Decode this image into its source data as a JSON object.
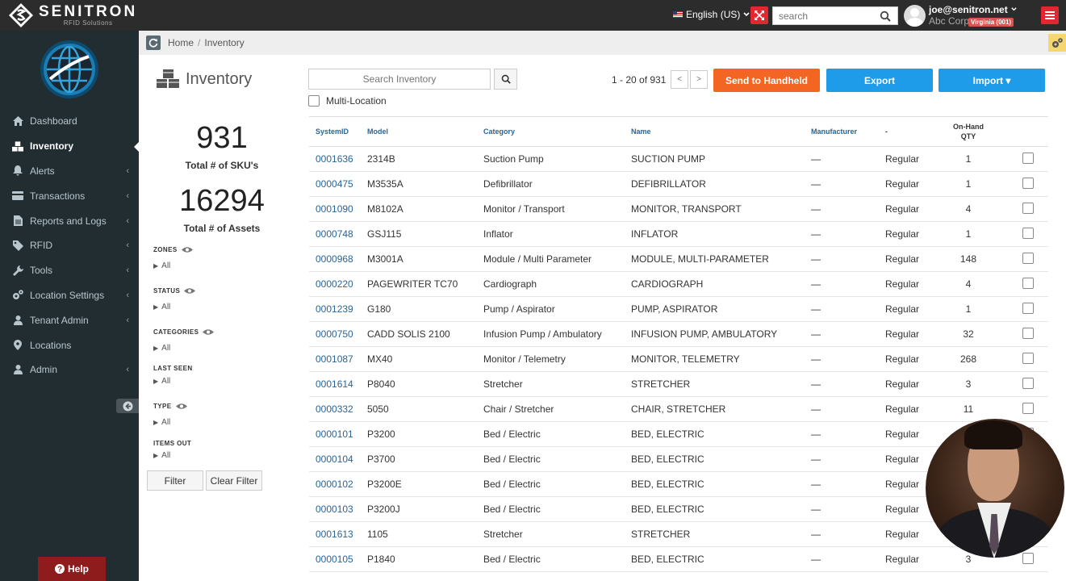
{
  "brand": {
    "name": "SENITRON",
    "sub": "RFID Solutions"
  },
  "topbar": {
    "language": "English (US)",
    "search_placeholder": "search",
    "user_email": "joe@senitron.net",
    "user_company": "Abc Corp",
    "user_location_badge": "Virginia (001)"
  },
  "sidebar": {
    "items": [
      {
        "label": "Dashboard",
        "icon": "home-icon",
        "active": false,
        "has_children": false
      },
      {
        "label": "Inventory",
        "icon": "cubes-icon",
        "active": true,
        "has_children": false
      },
      {
        "label": "Alerts",
        "icon": "bell-icon",
        "active": false,
        "has_children": true
      },
      {
        "label": "Transactions",
        "icon": "card-icon",
        "active": false,
        "has_children": true
      },
      {
        "label": "Reports and Logs",
        "icon": "file-icon",
        "active": false,
        "has_children": true
      },
      {
        "label": "RFID",
        "icon": "tag-icon",
        "active": false,
        "has_children": true
      },
      {
        "label": "Tools",
        "icon": "wrench-icon",
        "active": false,
        "has_children": true
      },
      {
        "label": "Location Settings",
        "icon": "cogs-icon",
        "active": false,
        "has_children": true
      },
      {
        "label": "Tenant Admin",
        "icon": "user-icon",
        "active": false,
        "has_children": true
      },
      {
        "label": "Locations",
        "icon": "map-marker-icon",
        "active": false,
        "has_children": false
      },
      {
        "label": "Admin",
        "icon": "user-icon",
        "active": false,
        "has_children": true
      }
    ],
    "help_label": "Help"
  },
  "breadcrumb": {
    "home": "Home",
    "current": "Inventory"
  },
  "summary": {
    "title": "Inventory",
    "sku_count": "931",
    "sku_label": "Total # of SKU's",
    "asset_count": "16294",
    "asset_label": "Total # of Assets"
  },
  "filters": {
    "groups": [
      {
        "label": "ZONES",
        "value": "All",
        "has_eye": true
      },
      {
        "label": "STATUS",
        "value": "All",
        "has_eye": true
      },
      {
        "label": "CATEGORIES",
        "value": "All",
        "has_eye": true
      },
      {
        "label": "LAST SEEN",
        "value": "All",
        "has_eye": false
      },
      {
        "label": "TYPE",
        "value": "All",
        "has_eye": true
      },
      {
        "label": "ITEMS OUT",
        "value": "All",
        "has_eye": false
      }
    ],
    "filter_label": "Filter",
    "clear_label": "Clear Filter"
  },
  "toolbar": {
    "search_placeholder": "Search Inventory",
    "multi_location_label": "Multi-Location",
    "pagination_text": "1 - 20 of 931",
    "prev_label": "<",
    "next_label": ">",
    "send_label": "Send to Handheld",
    "export_label": "Export",
    "import_label": "Import ▾",
    "colors": {
      "send": "#f26522",
      "export": "#1e9be9",
      "import": "#1e9be9"
    }
  },
  "table": {
    "columns": [
      "SystemID",
      "Model",
      "Category",
      "Name",
      "Manufacturer",
      "-",
      "On-Hand QTY"
    ],
    "rows": [
      {
        "id": "0001636",
        "model": "2314B",
        "category": "Suction Pump",
        "name": "SUCTION PUMP",
        "manufacturer": "—",
        "type": "Regular",
        "qty": "1"
      },
      {
        "id": "0000475",
        "model": "M3535A",
        "category": "Defibrillator",
        "name": "DEFIBRILLATOR",
        "manufacturer": "—",
        "type": "Regular",
        "qty": "1"
      },
      {
        "id": "0001090",
        "model": "M8102A",
        "category": "Monitor / Transport",
        "name": "MONITOR, TRANSPORT",
        "manufacturer": "—",
        "type": "Regular",
        "qty": "4"
      },
      {
        "id": "0000748",
        "model": "GSJ115",
        "category": "Inflator",
        "name": "INFLATOR",
        "manufacturer": "—",
        "type": "Regular",
        "qty": "1"
      },
      {
        "id": "0000968",
        "model": "M3001A",
        "category": "Module / Multi Parameter",
        "name": "MODULE, MULTI-PARAMETER",
        "manufacturer": "—",
        "type": "Regular",
        "qty": "148"
      },
      {
        "id": "0000220",
        "model": "PAGEWRITER TC70",
        "category": "Cardiograph",
        "name": "CARDIOGRAPH",
        "manufacturer": "—",
        "type": "Regular",
        "qty": "4"
      },
      {
        "id": "0001239",
        "model": "G180",
        "category": "Pump / Aspirator",
        "name": "PUMP, ASPIRATOR",
        "manufacturer": "—",
        "type": "Regular",
        "qty": "1"
      },
      {
        "id": "0000750",
        "model": "CADD SOLIS 2100",
        "category": "Infusion Pump / Ambulatory",
        "name": "INFUSION PUMP, AMBULATORY",
        "manufacturer": "—",
        "type": "Regular",
        "qty": "32"
      },
      {
        "id": "0001087",
        "model": "MX40",
        "category": "Monitor / Telemetry",
        "name": "MONITOR, TELEMETRY",
        "manufacturer": "—",
        "type": "Regular",
        "qty": "268"
      },
      {
        "id": "0001614",
        "model": "P8040",
        "category": "Stretcher",
        "name": "STRETCHER",
        "manufacturer": "—",
        "type": "Regular",
        "qty": "3"
      },
      {
        "id": "0000332",
        "model": "5050",
        "category": "Chair / Stretcher",
        "name": "CHAIR, STRETCHER",
        "manufacturer": "—",
        "type": "Regular",
        "qty": "11"
      },
      {
        "id": "0000101",
        "model": "P3200",
        "category": "Bed / Electric",
        "name": "BED, ELECTRIC",
        "manufacturer": "—",
        "type": "Regular",
        "qty": ""
      },
      {
        "id": "0000104",
        "model": "P3700",
        "category": "Bed / Electric",
        "name": "BED, ELECTRIC",
        "manufacturer": "—",
        "type": "Regular",
        "qty": ""
      },
      {
        "id": "0000102",
        "model": "P3200E",
        "category": "Bed / Electric",
        "name": "BED, ELECTRIC",
        "manufacturer": "—",
        "type": "Regular",
        "qty": ""
      },
      {
        "id": "0000103",
        "model": "P3200J",
        "category": "Bed / Electric",
        "name": "BED, ELECTRIC",
        "manufacturer": "—",
        "type": "Regular",
        "qty": ""
      },
      {
        "id": "0001613",
        "model": "1105",
        "category": "Stretcher",
        "name": "STRETCHER",
        "manufacturer": "—",
        "type": "Regular",
        "qty": ""
      },
      {
        "id": "0000105",
        "model": "P1840",
        "category": "Bed / Electric",
        "name": "BED, ELECTRIC",
        "manufacturer": "—",
        "type": "Regular",
        "qty": "3"
      }
    ]
  }
}
